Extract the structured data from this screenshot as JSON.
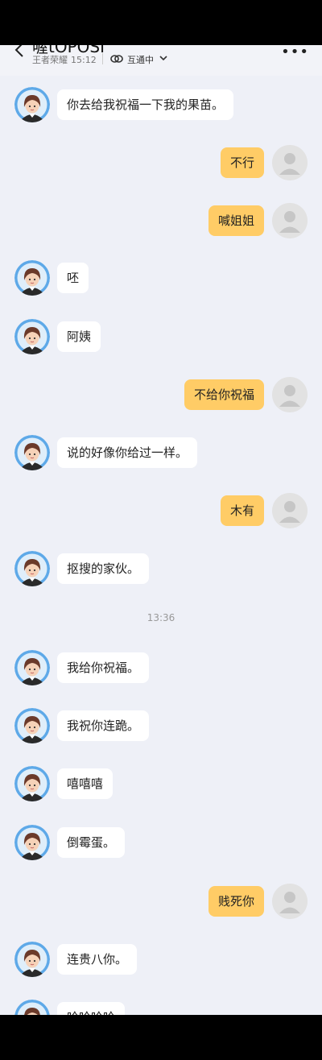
{
  "header": {
    "title": "喔tOPOSI",
    "game": "王者荣耀",
    "time": "15:12",
    "status": "互通中"
  },
  "colors": {
    "background": "#eef0f7",
    "incoming_bubble": "#ffffff",
    "outgoing_bubble": "#ffcc66",
    "avatar_ring": "#5ea9e8"
  },
  "messages": [
    {
      "side": "in",
      "text": "你去给我祝福一下我的果苗。"
    },
    {
      "side": "out",
      "text": "不行"
    },
    {
      "side": "out",
      "text": "喊姐姐"
    },
    {
      "side": "in",
      "text": "呸"
    },
    {
      "side": "in",
      "text": "阿姨"
    },
    {
      "side": "out",
      "text": "不给你祝福"
    },
    {
      "side": "in",
      "text": "说的好像你给过一样。"
    },
    {
      "side": "out",
      "text": "木有"
    },
    {
      "side": "in",
      "text": "抠搜的家伙。"
    },
    {
      "type": "timestamp",
      "text": "13:36"
    },
    {
      "side": "in",
      "text": "我给你祝福。"
    },
    {
      "side": "in",
      "text": "我祝你连跪。"
    },
    {
      "side": "in",
      "text": "嘻嘻嘻"
    },
    {
      "side": "in",
      "text": "倒霉蛋。"
    },
    {
      "side": "out",
      "text": "贱死你"
    },
    {
      "side": "in",
      "text": "连贵八你。"
    },
    {
      "side": "in",
      "text": "哈哈哈哈"
    }
  ]
}
